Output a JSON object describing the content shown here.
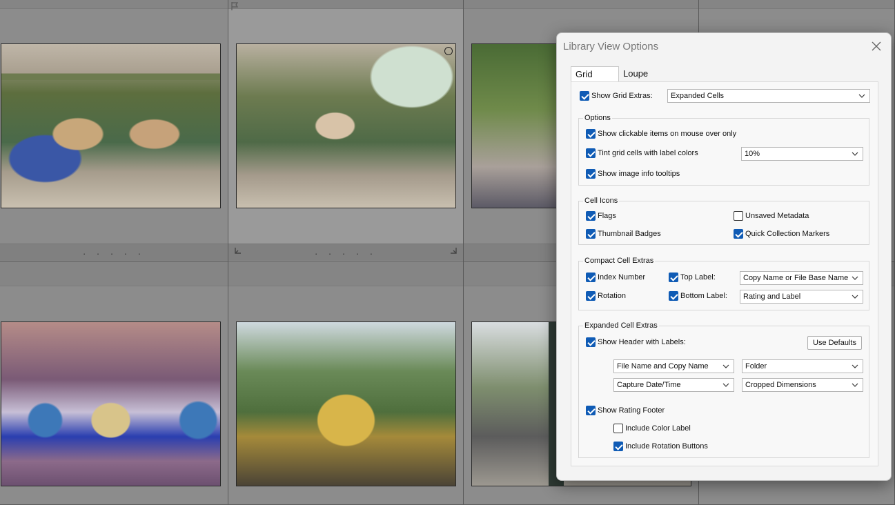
{
  "dialog": {
    "title": "Library View Options",
    "tabs": [
      {
        "label": "Grid View",
        "active": true
      },
      {
        "label": "Loupe View",
        "active": false
      }
    ],
    "show_grid_extras": {
      "label": "Show Grid Extras:",
      "checked": true,
      "value": "Expanded Cells"
    },
    "options": {
      "title": "Options",
      "clickable": {
        "label": "Show clickable items on mouse over only",
        "checked": true
      },
      "tint": {
        "label": "Tint grid cells with label colors",
        "checked": true,
        "value": "10%"
      },
      "tooltips": {
        "label": "Show image info tooltips",
        "checked": true
      }
    },
    "cell_icons": {
      "title": "Cell Icons",
      "flags": {
        "label": "Flags",
        "checked": true
      },
      "unsaved": {
        "label": "Unsaved Metadata",
        "checked": false
      },
      "badges": {
        "label": "Thumbnail Badges",
        "checked": true
      },
      "markers": {
        "label": "Quick Collection Markers",
        "checked": true
      }
    },
    "compact": {
      "title": "Compact Cell Extras",
      "index": {
        "label": "Index Number",
        "checked": true
      },
      "rotation": {
        "label": "Rotation",
        "checked": true
      },
      "top_label": {
        "label": "Top Label:",
        "checked": true,
        "value": "Copy Name or File Base Name"
      },
      "bottom_label": {
        "label": "Bottom Label:",
        "checked": true,
        "value": "Rating and Label"
      }
    },
    "expanded": {
      "title": "Expanded Cell Extras",
      "header": {
        "label": "Show Header with Labels:",
        "checked": true
      },
      "use_defaults": "Use Defaults",
      "fields": [
        "File Name and Copy Name",
        "Folder",
        "Capture Date/Time",
        "Cropped Dimensions"
      ],
      "rating_footer": {
        "label": "Show Rating Footer",
        "checked": true
      },
      "color_label": {
        "label": "Include Color Label",
        "checked": false
      },
      "rotation_buttons": {
        "label": "Include Rotation Buttons",
        "checked": true
      }
    }
  },
  "grid": {
    "footer_dots": "· · · · ·"
  },
  "colors": {
    "accent": "#0f5bb5",
    "grid_bg": "#8c8c8c",
    "dialog_bg": "#f3f3f3"
  }
}
